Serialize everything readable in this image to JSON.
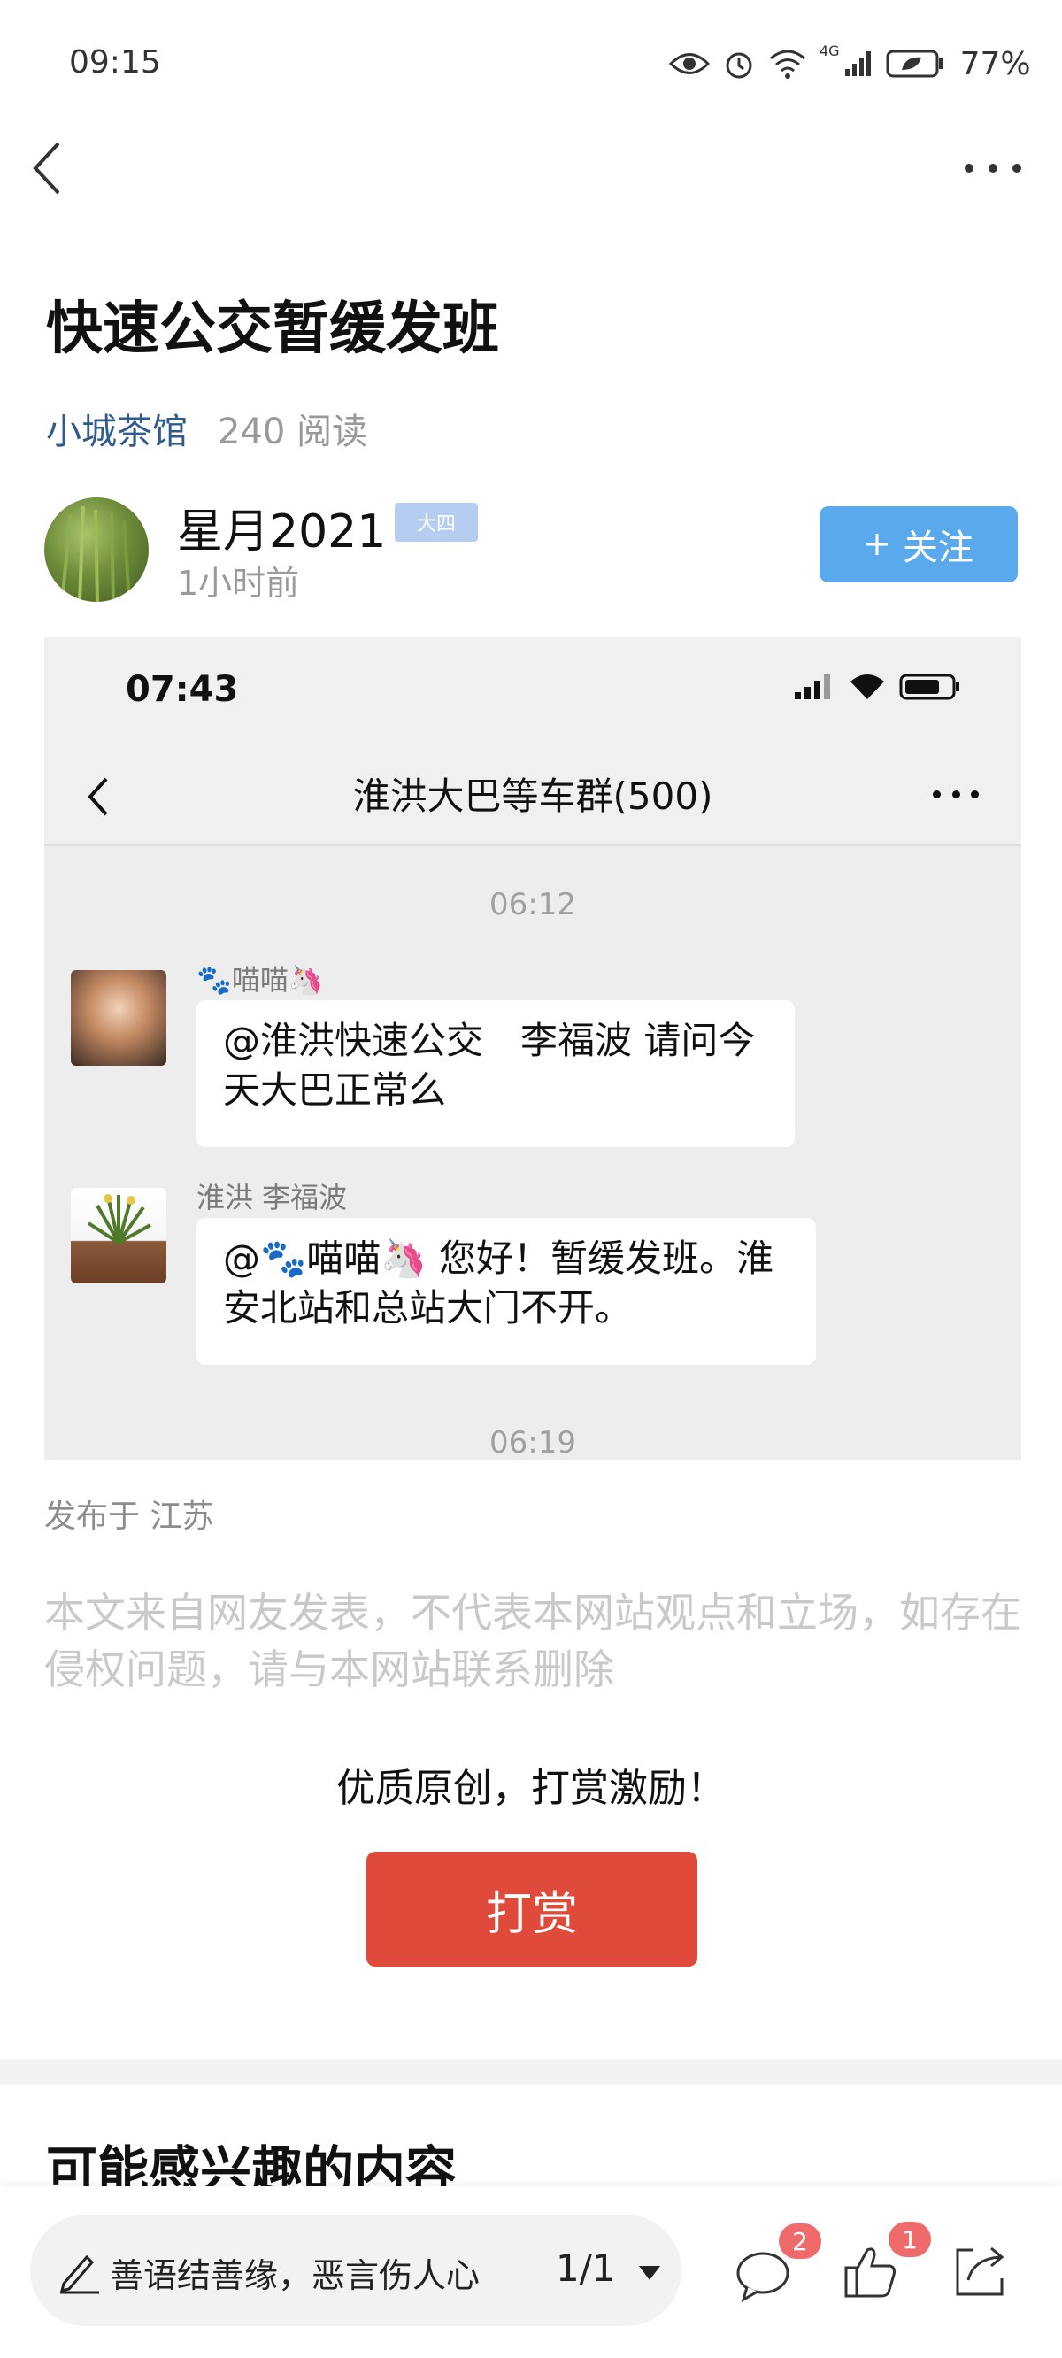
{
  "status_bar": {
    "time": "09:15",
    "network": "4G",
    "battery": "77%"
  },
  "article": {
    "title": "快速公交暂缓发班",
    "channel": "小城茶馆",
    "reads": "240 阅读",
    "author": {
      "name": "星月2021",
      "grade_badge": "大四",
      "time": "1小时前"
    },
    "follow_label": "关注",
    "location": "发布于 江苏",
    "disclaimer": "本文来自网友发表，不代表本网站观点和立场，如存在侵权问题，请与本网站联系删除",
    "reward_tip": "优质原创，打赏激励！",
    "reward_label": "打赏"
  },
  "embedded_chat": {
    "status_time": "07:43",
    "title": "淮洪大巴等车群(500)",
    "messages": [
      {
        "time": "06:12",
        "sender": "🐾喵喵🦄",
        "text": "@淮洪快速公交　李福波 请问今天大巴正常么"
      },
      {
        "sender": "淮洪 李福波",
        "text": "@🐾喵喵🦄 您好！暂缓发班。淮安北站和总站大门不开。"
      }
    ],
    "next_time": "06:19"
  },
  "recommend": {
    "title": "可能感兴趣的内容"
  },
  "bottom_bar": {
    "comment_placeholder": "善语结善缘，恶言伤人心",
    "page_indicator": "1/1",
    "comment_count": "2",
    "like_count": "1"
  },
  "colors": {
    "accent_blue": "#5aa9ec",
    "reward_red": "#e04a3a",
    "channel_blue": "#2f5a8c",
    "badge_red": "#ef6b6b"
  }
}
